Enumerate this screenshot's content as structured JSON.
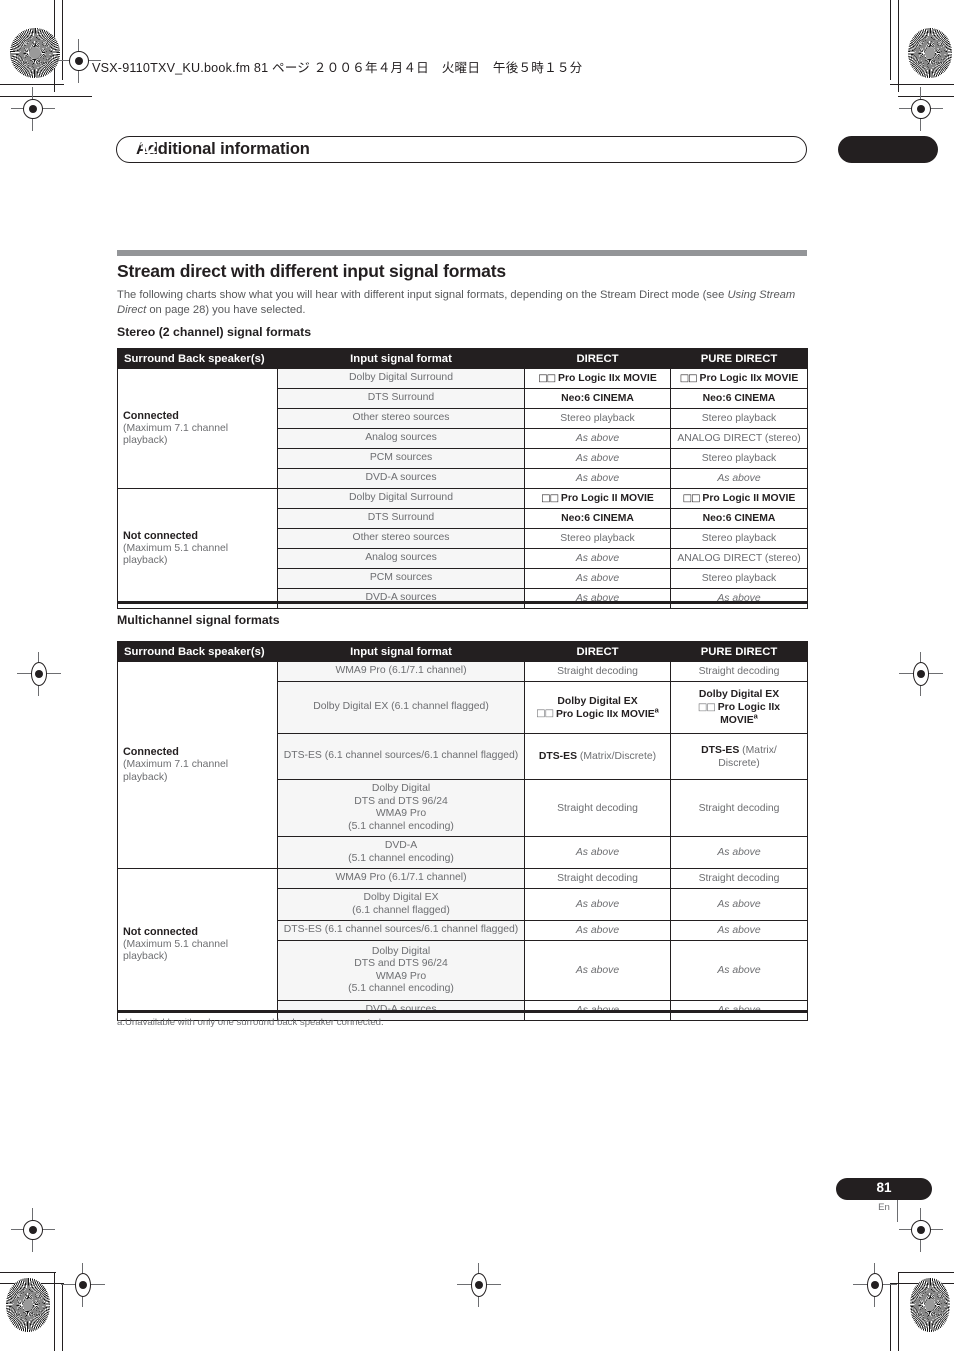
{
  "print_header": {
    "filename_line": "VSX-9110TXV_KU.book.fm 81 ページ ２００６年４月４日　火曜日　午後５時１５分"
  },
  "chapter": {
    "title": "Additional information",
    "number": "12"
  },
  "section": {
    "heading": "Stream direct with different input signal formats",
    "intro_part1": "The following charts show what you will hear with different input signal formats, depending on the Stream Direct mode (see ",
    "intro_italic": "Using Stream Direct",
    "intro_part2": " on page 28) you have selected.",
    "sub_heading_1": "Stereo (2 channel) signal formats",
    "sub_heading_2": "Multichannel signal formats"
  },
  "table_headers": {
    "col1": "Surround Back speaker(s)",
    "col2": "Input signal format",
    "col3": "DIRECT",
    "col4": "PURE DIRECT"
  },
  "speaker_groups": {
    "connected_name": "Connected",
    "connected_sub_l1": "(Maximum 7.1 channel",
    "connected_sub_l2": "playback)",
    "not_connected_name": "Not connected",
    "not_connected_sub_l1": "(Maximum 5.1 channel",
    "not_connected_sub_l2": "playback)"
  },
  "stereo_table": {
    "connected_rows": [
      {
        "signal": "Dolby Digital Surround",
        "direct": "Pro Logic IIx MOVIE",
        "direct_dolby": true,
        "direct_bold": true,
        "pure": "Pro Logic IIx MOVIE",
        "pure_dolby": true,
        "pure_bold": true
      },
      {
        "signal": "DTS Surround",
        "direct": "Neo:6 CINEMA",
        "direct_bold": true,
        "pure": "Neo:6 CINEMA",
        "pure_bold": true
      },
      {
        "signal": "Other stereo sources",
        "direct": "Stereo playback",
        "pure": "Stereo playback"
      },
      {
        "signal": "Analog sources",
        "direct": "As above",
        "direct_italic": true,
        "pure": "ANALOG DIRECT (stereo)"
      },
      {
        "signal": "PCM sources",
        "direct": "As above",
        "direct_italic": true,
        "pure": "Stereo playback"
      },
      {
        "signal": "DVD-A sources",
        "direct": "As above",
        "direct_italic": true,
        "pure": "As above",
        "pure_italic": true
      }
    ],
    "not_connected_rows": [
      {
        "signal": "Dolby Digital Surround",
        "direct": "Pro Logic II MOVIE",
        "direct_dolby": true,
        "direct_bold": true,
        "pure": "Pro Logic II MOVIE",
        "pure_dolby": true,
        "pure_bold": true
      },
      {
        "signal": "DTS Surround",
        "direct": "Neo:6 CINEMA",
        "direct_bold": true,
        "pure": "Neo:6 CINEMA",
        "pure_bold": true
      },
      {
        "signal": "Other stereo sources",
        "direct": "Stereo playback",
        "pure": "Stereo playback"
      },
      {
        "signal": "Analog sources",
        "direct": "As above",
        "direct_italic": true,
        "pure": "ANALOG DIRECT (stereo)"
      },
      {
        "signal": "PCM sources",
        "direct": "As above",
        "direct_italic": true,
        "pure": "Stereo playback"
      },
      {
        "signal": "DVD-A sources",
        "direct": "As above",
        "direct_italic": true,
        "pure": "As above",
        "pure_italic": true
      }
    ]
  },
  "multichannel_table": {
    "connected_rows": [
      {
        "signal": "WMA9 Pro (6.1/7.1 channel)",
        "direct": "Straight decoding",
        "pure": "Straight decoding"
      },
      {
        "signal": "Dolby Digital EX (6.1 channel flagged)",
        "direct_line1": "Dolby Digital EX",
        "direct_line2": "Pro Logic IIx MOVIE",
        "direct_line2_sup": "a",
        "pure_line1": "Dolby Digital EX",
        "pure_line2": "Pro Logic IIx",
        "pure_line3": "MOVIE",
        "pure_line3_sup": "a"
      },
      {
        "signal": "DTS-ES (6.1 channel sources/6.1 channel flagged)",
        "direct_bold_part": "DTS-ES",
        "direct_rest": " (Matrix/Discrete)",
        "pure_bold_part": "DTS-ES",
        "pure_rest_line1": " (Matrix/",
        "pure_rest_line2": "Discrete)"
      },
      {
        "signal_lines": [
          "Dolby Digital",
          "DTS and DTS 96/24",
          "WMA9 Pro",
          "(5.1 channel encoding)"
        ],
        "direct": "Straight decoding",
        "pure": "Straight decoding"
      },
      {
        "signal_lines": [
          "DVD-A",
          "(5.1 channel encoding)"
        ],
        "direct": "As above",
        "direct_italic": true,
        "pure": "As above",
        "pure_italic": true
      }
    ],
    "not_connected_rows": [
      {
        "signal": "WMA9 Pro (6.1/7.1 channel)",
        "direct": "Straight decoding",
        "pure": "Straight decoding"
      },
      {
        "signal_lines": [
          "Dolby Digital EX",
          "(6.1 channel flagged)"
        ],
        "direct": "As above",
        "direct_italic": true,
        "pure": "As above",
        "pure_italic": true
      },
      {
        "signal": "DTS-ES (6.1 channel sources/6.1 channel flagged)",
        "direct": "As above",
        "direct_italic": true,
        "pure": "As above",
        "pure_italic": true
      },
      {
        "signal_lines": [
          "Dolby Digital",
          "DTS and DTS 96/24",
          "WMA9 Pro",
          "(5.1 channel encoding)"
        ],
        "direct": "As above",
        "direct_italic": true,
        "pure": "As above",
        "pure_italic": true
      },
      {
        "signal": "DVD-A sources",
        "direct": "As above",
        "direct_italic": true,
        "pure": "As above",
        "pure_italic": true
      }
    ]
  },
  "footnote": "a.Unavailable with only one surround back speaker connected.",
  "page_footer": {
    "number": "81",
    "language": "En"
  }
}
